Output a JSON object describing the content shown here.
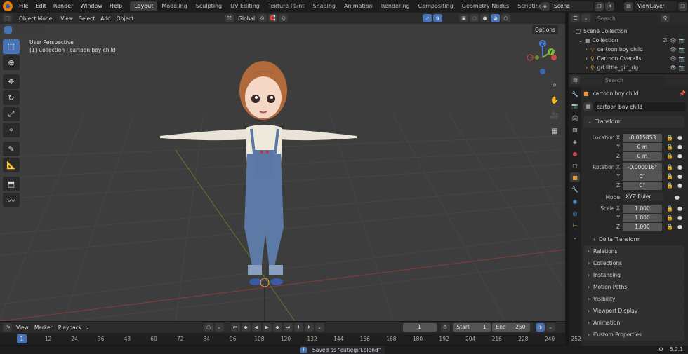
{
  "menus": [
    "File",
    "Edit",
    "Render",
    "Window",
    "Help"
  ],
  "workspaces": [
    "Layout",
    "Modeling",
    "Sculpting",
    "UV Editing",
    "Texture Paint",
    "Shading",
    "Animation",
    "Rendering",
    "Compositing",
    "Geometry Nodes",
    "Scripting"
  ],
  "active_workspace": "Layout",
  "add_tab": "+",
  "scene": "Scene",
  "view_layer": "ViewLayer",
  "viewport_header": {
    "mode": "Object Mode",
    "items": [
      "View",
      "Select",
      "Add",
      "Object"
    ],
    "transform": "Global",
    "options": "Options"
  },
  "viewport_info": {
    "line1": "User Perspective",
    "line2": "(1) Collection | cartoon boy child"
  },
  "gizmo": {
    "z": "Z",
    "y": "Y"
  },
  "outliner": {
    "search_placeholder": "Search",
    "root": "Scene Collection",
    "collection": "Collection",
    "items": [
      "cartoon boy child",
      "Cartoon Overalls",
      "grl:little_girl_rig"
    ]
  },
  "properties": {
    "search_placeholder": "Search",
    "object_name": "cartoon boy child",
    "data_name": "cartoon boy child",
    "transform_title": "Transform",
    "location": {
      "label": "Location X",
      "x": "-0.015853",
      "y": "0 m",
      "z": "0 m"
    },
    "rotation": {
      "label": "Rotation X",
      "x": "-0.000016°",
      "y": "0°",
      "z": "0°"
    },
    "mode_label": "Mode",
    "mode": "XYZ Euler",
    "scale": {
      "label": "Scale X",
      "x": "1.000",
      "y": "1.000",
      "z": "1.000"
    },
    "axis_y": "Y",
    "axis_z": "Z",
    "sections": [
      "Delta Transform",
      "Relations",
      "Collections",
      "Instancing",
      "Motion Paths",
      "Visibility",
      "Viewport Display",
      "Animation",
      "Custom Properties"
    ]
  },
  "timeline": {
    "menus": [
      "View",
      "Marker",
      "Playback"
    ],
    "current_frame": "1",
    "start_label": "Start",
    "start": "1",
    "end_label": "End",
    "end": "250",
    "ticks": [
      "1",
      "12",
      "24",
      "36",
      "48",
      "60",
      "72",
      "84",
      "96",
      "108",
      "120",
      "132",
      "144",
      "156",
      "168",
      "180",
      "192",
      "204",
      "216",
      "228",
      "240",
      "252"
    ]
  },
  "status": {
    "message": "Saved as \"cutiegirl.blend\"",
    "version": "5.2.1"
  },
  "colors": {
    "accent": "#4772b3",
    "header": "#2b2b2b",
    "viewport": "#3d3d3d",
    "panel": "#282828"
  }
}
